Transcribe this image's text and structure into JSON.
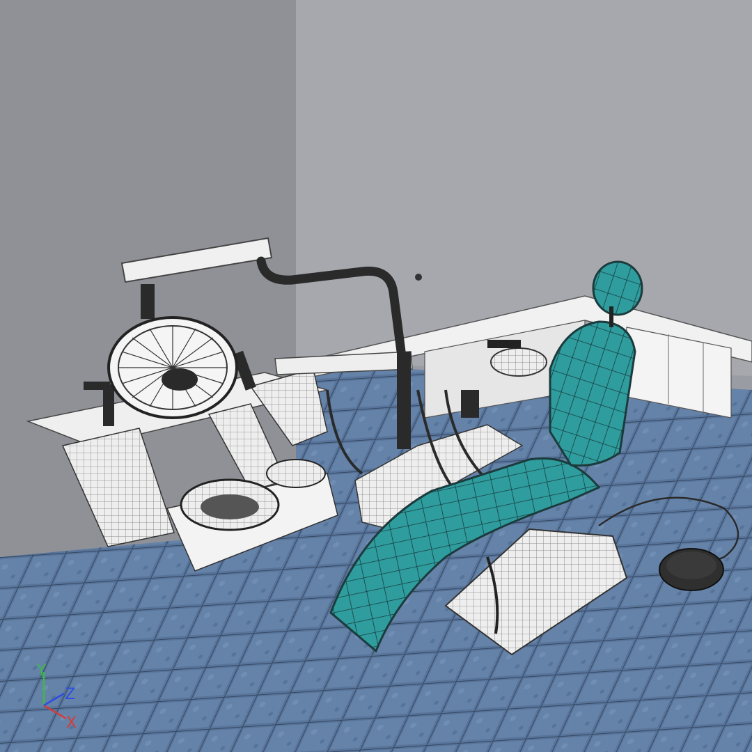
{
  "viewport": {
    "axes": {
      "x": "X",
      "y": "Y",
      "z": "Z"
    }
  },
  "colors": {
    "wall_left": "#8f9196",
    "wall_right": "#a6a8ad",
    "floor_tile": "#58749a",
    "grout": "#33465f",
    "seat_teal": "#2f9c9e",
    "wire_dark": "#2a2a2a",
    "model_white": "#f2f2f2",
    "axis_x": "#d23c3c",
    "axis_y": "#3fb84a",
    "axis_z": "#2d4de0"
  },
  "scene_objects": [
    "wall-left",
    "wall-right",
    "floor",
    "cabinet-counter",
    "operating-light",
    "light-arm",
    "instrument-delivery-unit",
    "spittoon-bowl",
    "dental-chair",
    "chair-headrest",
    "chair-base",
    "foot-control-pedal"
  ]
}
